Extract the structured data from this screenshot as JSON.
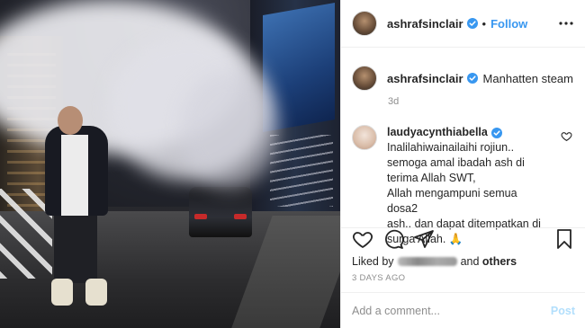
{
  "post": {
    "username": "ashrafsinclair",
    "follow_label": "Follow",
    "separator": "•",
    "caption": "Manhatten steam",
    "time_ago": "3d"
  },
  "comment": {
    "username": "laudyacynthiabella",
    "lines": [
      "Inalilahiwainailaihi rojiun..",
      "semoga amal ibadah ash di",
      "terima Allah SWT,",
      "Allah mengampuni semua dosa2",
      "ash.. dan dapat ditempatkan di",
      "surga Allah. 🙏"
    ]
  },
  "likes": {
    "prefix": "Liked by",
    "suffix_and": "and",
    "others": "others"
  },
  "posted_ago": "3 DAYS AGO",
  "add_comment": {
    "placeholder": "Add a comment...",
    "post_label": "Post"
  },
  "colors": {
    "accent": "#3897f0",
    "verified": "#3897f0",
    "muted": "#8e8e8e",
    "post_disabled": "#b2dffc"
  },
  "icons": [
    "verified-badge-icon",
    "more-options-icon",
    "heart-icon",
    "comment-icon",
    "share-icon",
    "bookmark-icon"
  ]
}
